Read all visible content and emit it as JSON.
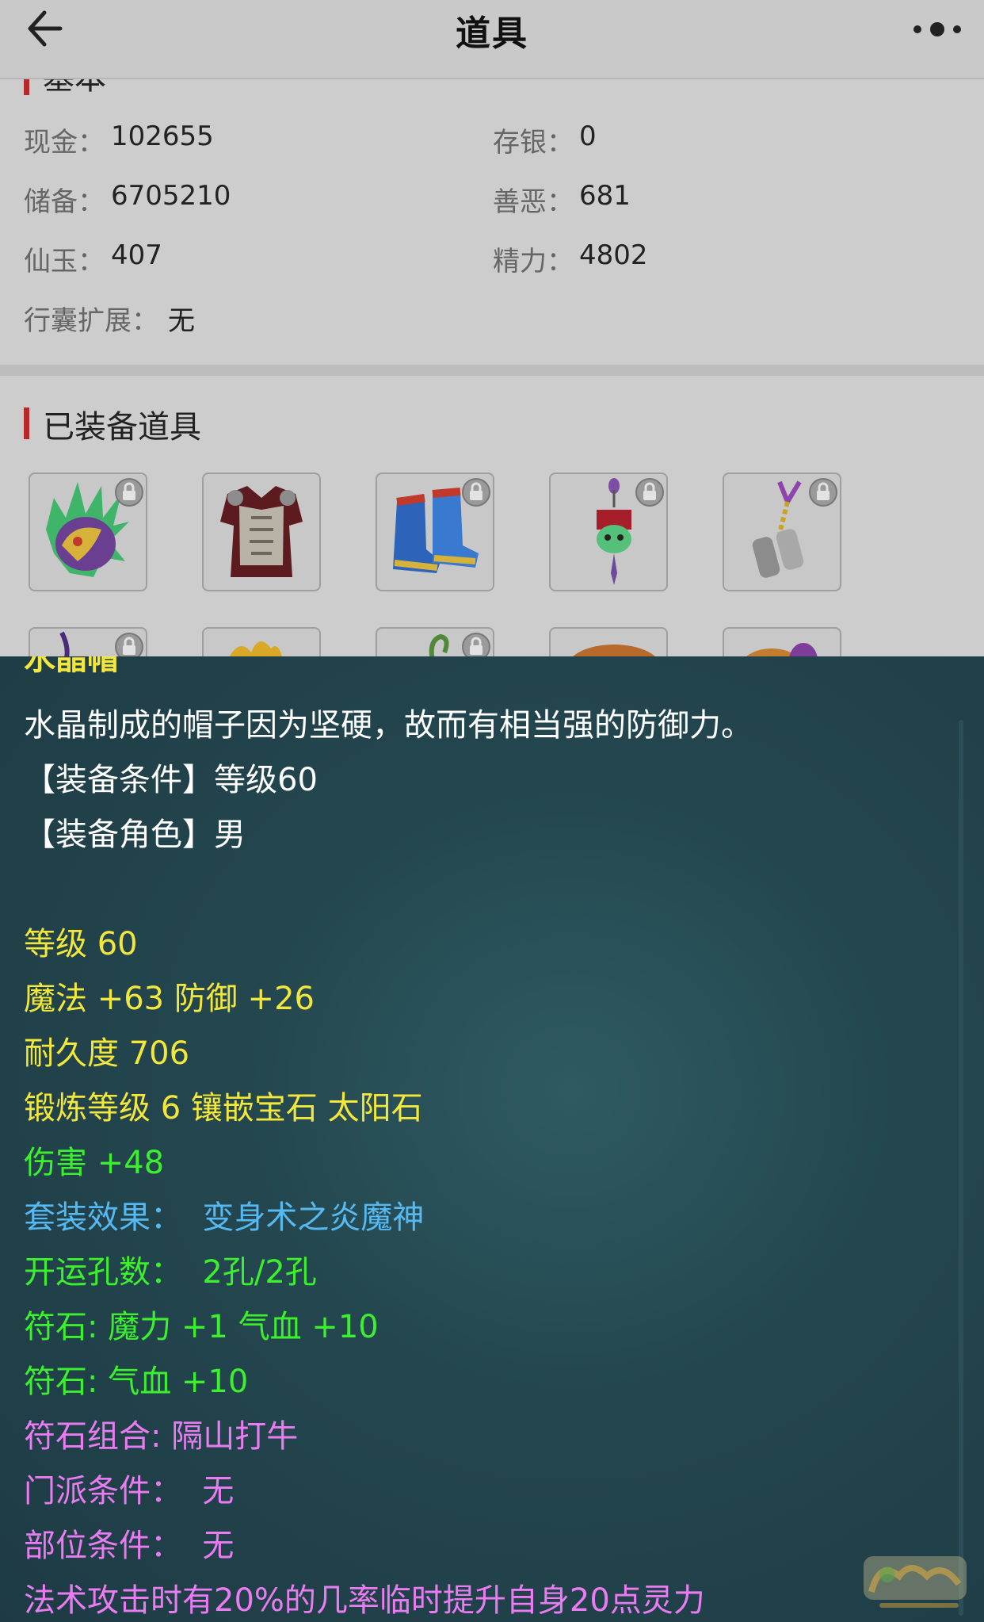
{
  "header": {
    "title": "道具",
    "back_icon": "back-arrow-icon",
    "more_icon": "more-options-icon"
  },
  "basic": {
    "section_title": "基本",
    "fields": {
      "cash_label": "现金：",
      "cash_value": "102655",
      "bank_label": "存银：",
      "bank_value": "0",
      "reserve_label": "储备：",
      "reserve_value": "6705210",
      "karma_label": "善恶：",
      "karma_value": "681",
      "jade_label": "仙玉：",
      "jade_value": "407",
      "energy_label": "精力：",
      "energy_value": "4802",
      "bag_label": "行囊扩展：",
      "bag_value": "无"
    }
  },
  "equipped": {
    "section_title": "已装备道具",
    "items": [
      {
        "name": "helmet",
        "locked": true
      },
      {
        "name": "armor",
        "locked": false
      },
      {
        "name": "boots",
        "locked": true
      },
      {
        "name": "necklace",
        "locked": true
      },
      {
        "name": "belt",
        "locked": true
      },
      {
        "name": "weapon",
        "locked": true
      },
      {
        "name": "leaf-accessory",
        "locked": false
      },
      {
        "name": "ring",
        "locked": true
      },
      {
        "name": "hat",
        "locked": false
      },
      {
        "name": "headwear",
        "locked": false
      }
    ]
  },
  "detail": {
    "item_name": "水晶帽",
    "description": "水晶制成的帽子因为坚硬，故而有相当强的防御力。",
    "condition": "【装备条件】等级60",
    "role": "【装备角色】男",
    "level": "等级 60",
    "magic_defense": "魔法 +63 防御 +26",
    "durability": "耐久度 706",
    "forge": "锻炼等级 6 镶嵌宝石 太阳石",
    "damage": "伤害 +48",
    "set_effect": "套装效果：  变身术之炎魔神",
    "luck_holes": "开运孔数：  2孔/2孔",
    "rune1": "符石: 魔力 +1 气血 +10",
    "rune2": "符石: 气血 +10",
    "rune_combo": "符石组合: 隔山打牛",
    "sect_condition": "门派条件：  无",
    "part_condition": "部位条件：  无",
    "special_effect": "法术攻击时有20%的几率临时提升自身20点灵力",
    "colors": {
      "white": "#ffffff",
      "yellow": "#f2e73a",
      "green": "#3cf02e",
      "blue": "#56b9f1",
      "pink": "#ea7cf2"
    }
  }
}
